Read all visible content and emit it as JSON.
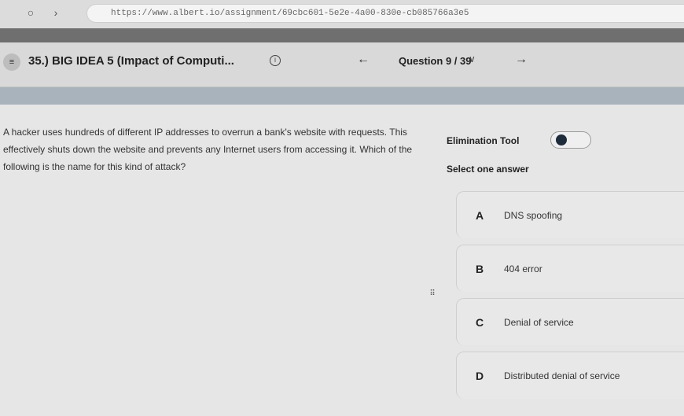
{
  "browser": {
    "url": "https://www.albert.io/assignment/69cbc601-5e2e-4a00-830e-cb085766a3e5"
  },
  "header": {
    "title": "35.) BIG IDEA 5 (Impact of Computi...",
    "question_counter": "Question 9 / 39"
  },
  "question": {
    "text": "A hacker uses hundreds of different IP addresses to overrun a bank's website with requests. This effectively shuts down the website and prevents any Internet users from accessing it. Which of the following is the name for this kind of attack?"
  },
  "tools": {
    "elimination_label": "Elimination Tool",
    "select_label": "Select one answer"
  },
  "options": [
    {
      "letter": "A",
      "text": "DNS spoofing"
    },
    {
      "letter": "B",
      "text": "404 error"
    },
    {
      "letter": "C",
      "text": "Denial of service"
    },
    {
      "letter": "D",
      "text": "Distributed denial of service"
    }
  ],
  "icons": {
    "back": "back-arrow-icon",
    "forward": "forward-arrow-icon",
    "menu": "menu-icon",
    "info": "info-icon",
    "prev": "prev-question-icon",
    "next": "next-question-icon",
    "dropdown": "chevron-down-icon"
  }
}
